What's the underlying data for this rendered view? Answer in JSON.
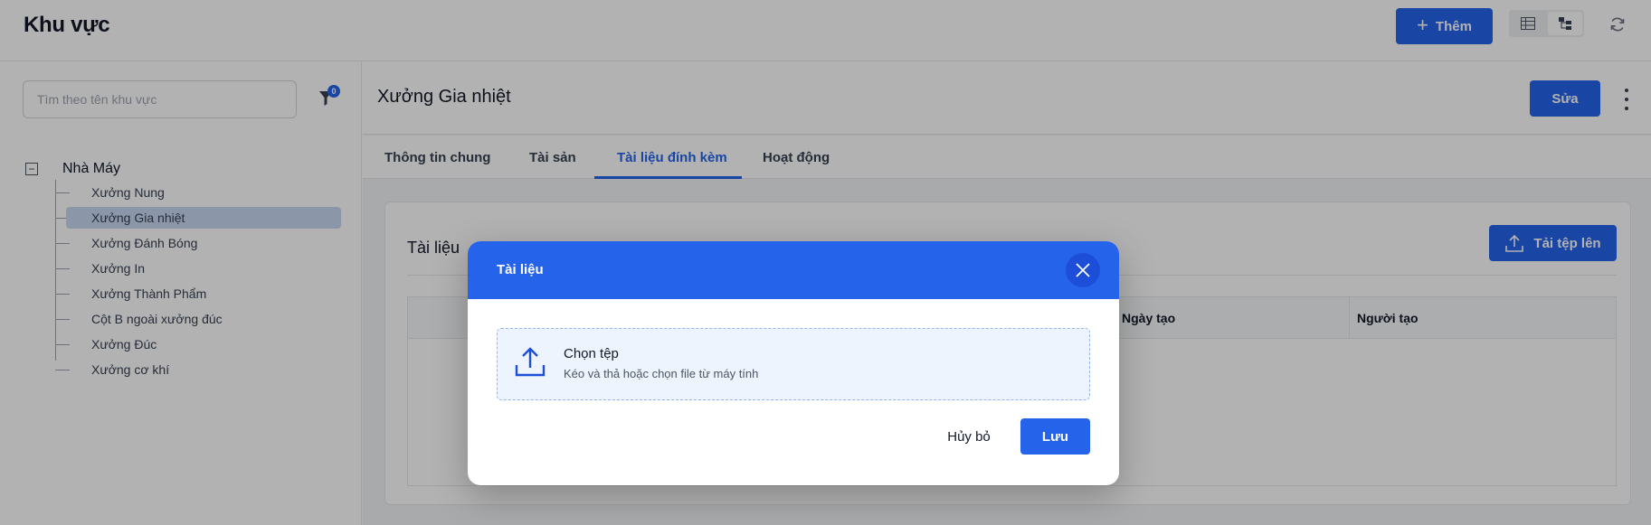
{
  "header": {
    "title": "Khu vực",
    "add_label": "Thêm",
    "add_icon": "plus-icon",
    "view_toggle": {
      "options": [
        "table-view-icon",
        "tree-view-icon"
      ],
      "active": "tree-view-icon"
    },
    "refresh_icon": "refresh-icon"
  },
  "sidebar": {
    "search": {
      "placeholder": "Tìm theo tên khu vực",
      "value": ""
    },
    "filter": {
      "icon": "filter-icon",
      "badge": "0"
    },
    "tree": {
      "root": {
        "label": "Nhà Máy",
        "expanded": true
      },
      "children": [
        {
          "label": "Xưởng Nung"
        },
        {
          "label": "Xưởng Gia nhiệt",
          "selected": true
        },
        {
          "label": "Xưởng Đánh Bóng"
        },
        {
          "label": "Xưởng In"
        },
        {
          "label": "Xưởng Thành Phẩm"
        },
        {
          "label": "Cột B ngoài xưởng đúc"
        },
        {
          "label": "Xưởng Đúc"
        },
        {
          "label": "Xưởng cơ khí"
        }
      ]
    }
  },
  "main": {
    "title": "Xưởng Gia nhiệt",
    "edit_label": "Sửa",
    "tabs": [
      {
        "label": "Thông tin chung"
      },
      {
        "label": "Tài sản"
      },
      {
        "label": "Tài liệu đính kèm",
        "active": true
      },
      {
        "label": "Hoạt động"
      }
    ],
    "documents": {
      "title": "Tài liệu",
      "upload_label": "Tải tệp lên",
      "columns": [
        "",
        "Ngày tạo",
        "Người tạo"
      ]
    }
  },
  "modal": {
    "title": "Tài liệu",
    "dropzone": {
      "title": "Chọn tệp",
      "hint": "Kéo và thả hoặc chọn file từ máy tính"
    },
    "cancel_label": "Hủy bỏ",
    "save_label": "Lưu"
  },
  "colors": {
    "accent": "#2563eb",
    "selected_bg": "#c7d7f2",
    "dropzone_bg": "#eef4fd"
  }
}
